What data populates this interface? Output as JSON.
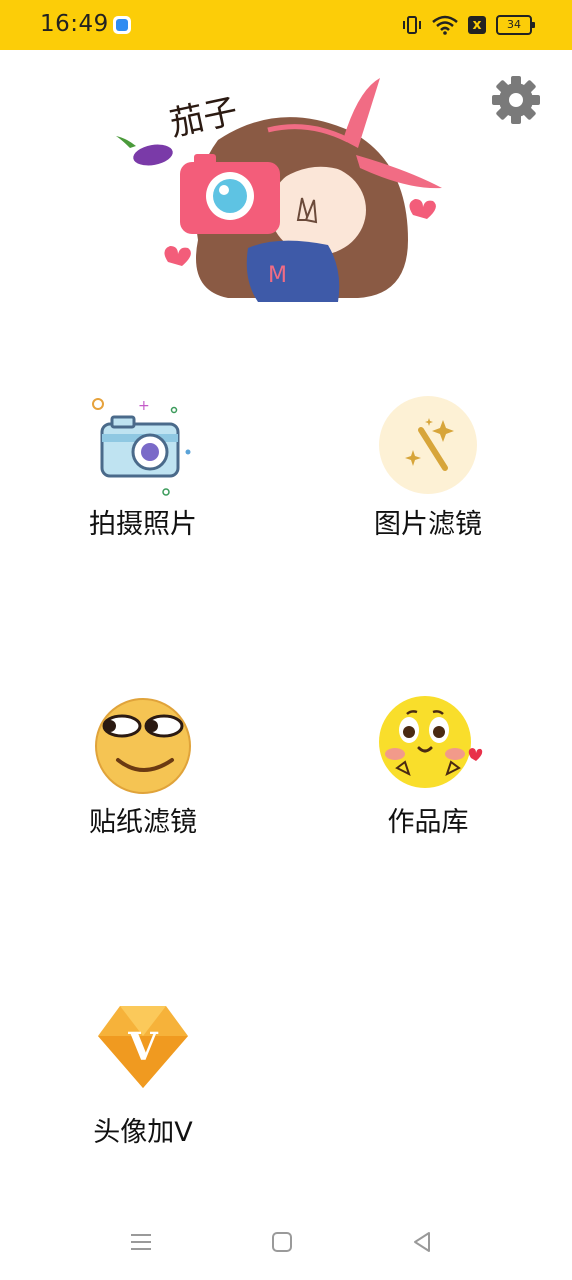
{
  "status_bar": {
    "time": "16:49",
    "battery_level": "34",
    "mute_label": "x",
    "background": "#fccd08"
  },
  "header": {
    "settings_icon": "gear-icon",
    "banner": {
      "title": "茄子",
      "description_icon": "girl-with-camera-illustration"
    }
  },
  "features": [
    {
      "label": "拍摄照片",
      "icon": "camera-icon"
    },
    {
      "label": "图片滤镜",
      "icon": "magic-wand-icon"
    },
    {
      "label": "贴纸滤镜",
      "icon": "smug-emoji-icon"
    },
    {
      "label": "作品库",
      "icon": "blushing-emoji-icon"
    },
    {
      "label": "头像加V",
      "icon": "v-diamond-icon"
    }
  ],
  "nav_bar": {
    "menu_icon": "menu-icon",
    "home_icon": "home-icon",
    "back_icon": "back-icon"
  }
}
